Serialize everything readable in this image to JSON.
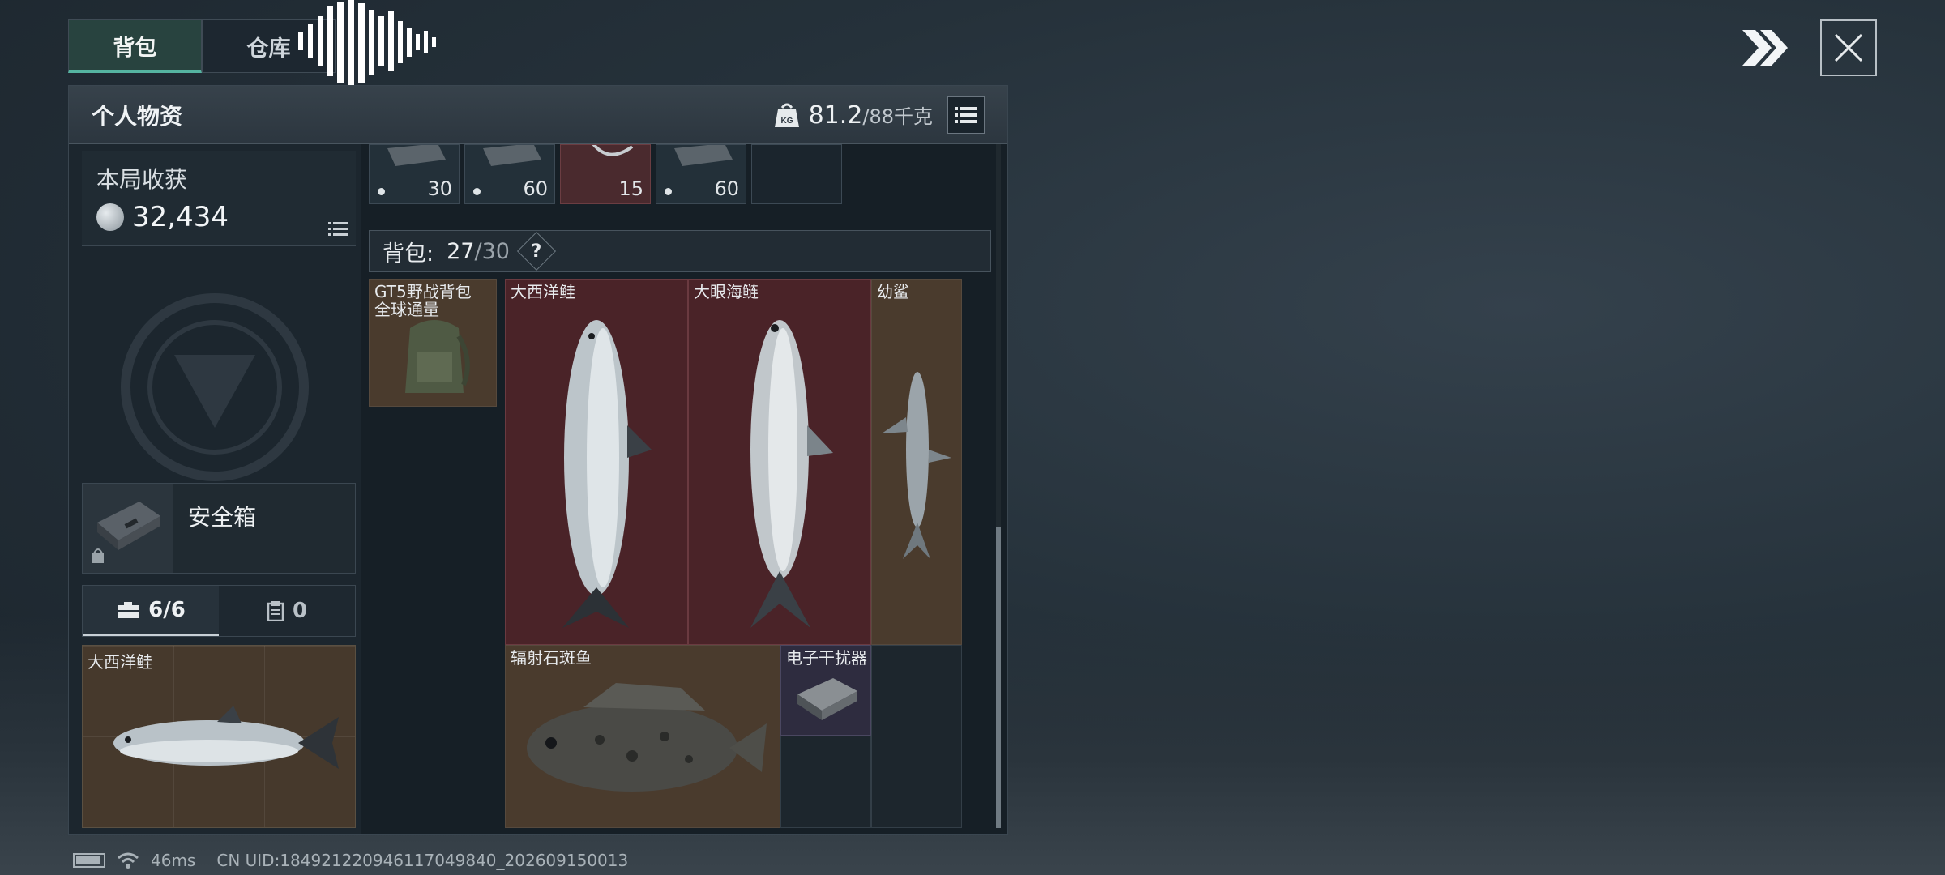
{
  "tabs": [
    {
      "label": "背包",
      "active": true
    },
    {
      "label": "仓库",
      "active": false
    }
  ],
  "panel": {
    "title": "个人物资",
    "weight_current": "81.2",
    "weight_max": "/88千克",
    "weight_icon": "kg-weight-icon"
  },
  "harvest": {
    "label": "本局收获",
    "value": "32,434"
  },
  "safebox": {
    "label": "安全箱"
  },
  "secure_tabs": [
    {
      "label": "6/6",
      "icon": "toolbox-icon",
      "active": true
    },
    {
      "label": "0",
      "icon": "clipboard-icon",
      "active": false
    }
  ],
  "secure_item": {
    "name": "大西洋鲑"
  },
  "ammo": [
    {
      "count": "30",
      "color": "#233039"
    },
    {
      "count": "60",
      "color": "#233039"
    },
    {
      "count": "15",
      "color": "#4a2a2e"
    },
    {
      "count": "60",
      "color": "#233039"
    }
  ],
  "bag": {
    "label": "背包:",
    "used": "27",
    "capacity": "/30",
    "help": "?"
  },
  "items": [
    {
      "name": "GT5野战背包 全球通量"
    },
    {
      "name": "大西洋鲑"
    },
    {
      "name": "大眼海鲢"
    },
    {
      "name": "幼鲨"
    },
    {
      "name": "辐射石斑鱼"
    },
    {
      "name": "电子干扰器"
    }
  ],
  "status": {
    "ping": "46ms",
    "uid": "CN UID:184921220946117049840_202609150013"
  },
  "colors": {
    "accent": "#55b4a1",
    "rare_red": "#4a2328",
    "common_brown": "#4a3b2d",
    "epic_purple": "#2e2c3f"
  }
}
